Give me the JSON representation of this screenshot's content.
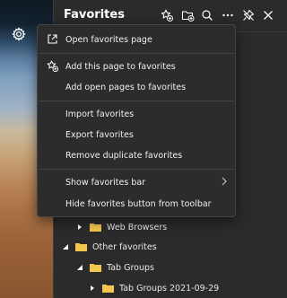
{
  "panel": {
    "title": "Favorites"
  },
  "header_icons": [
    "add-favorite-icon",
    "add-folder-icon",
    "search-icon",
    "more-icon",
    "pin-icon",
    "close-icon"
  ],
  "menu": {
    "items": [
      {
        "label": "Open favorites page",
        "icon": "open-external-icon"
      },
      {
        "label": "Add this page to favorites",
        "icon": "add-favorite-icon"
      },
      {
        "label": "Add open pages to favorites"
      },
      {
        "label": "Import favorites"
      },
      {
        "label": "Export favorites"
      },
      {
        "label": "Remove duplicate favorites"
      },
      {
        "label": "Show favorites bar",
        "has_submenu": true
      },
      {
        "label": "Hide favorites button from toolbar"
      }
    ]
  },
  "tree": {
    "rows": [
      {
        "label": "Web Browsers",
        "expanded": false
      },
      {
        "label": "Other favorites",
        "expanded": true
      },
      {
        "label": "Tab Groups",
        "expanded": true
      },
      {
        "label": "Tab Groups 2021-09-29",
        "expanded": false
      }
    ]
  },
  "colors": {
    "panel_bg": "#2b2b2b",
    "menu_bg": "#2c2c2c",
    "folder": "#f3c64d",
    "text": "#ffffff"
  }
}
